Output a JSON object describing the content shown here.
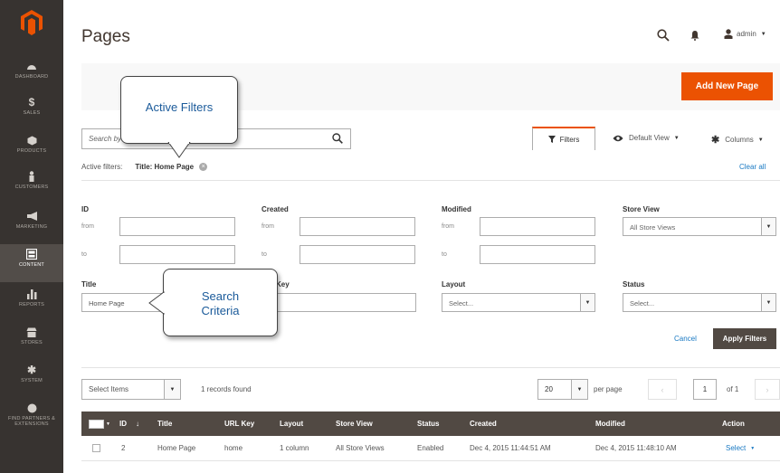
{
  "sidebar": {
    "items": [
      {
        "label": "DASHBOARD",
        "icon": "dashboard-icon"
      },
      {
        "label": "SALES",
        "icon": "dollar-icon"
      },
      {
        "label": "PRODUCTS",
        "icon": "cube-icon"
      },
      {
        "label": "CUSTOMERS",
        "icon": "person-icon"
      },
      {
        "label": "MARKETING",
        "icon": "megaphone-icon"
      },
      {
        "label": "CONTENT",
        "icon": "content-icon"
      },
      {
        "label": "REPORTS",
        "icon": "bar-chart-icon"
      },
      {
        "label": "STORES",
        "icon": "store-icon"
      },
      {
        "label": "SYSTEM",
        "icon": "gear-icon"
      },
      {
        "label": "FIND PARTNERS & EXTENSIONS",
        "icon": "partners-icon"
      }
    ]
  },
  "header": {
    "title": "Pages",
    "user": "admin",
    "add_button": "Add New Page"
  },
  "search": {
    "placeholder": "Search by keyword"
  },
  "toolbar": {
    "filters": "Filters",
    "default_view": "Default View",
    "columns": "Columns"
  },
  "active_filters": {
    "label": "Active filters:",
    "value": "Title: Home Page",
    "clear_all": "Clear all"
  },
  "filters": {
    "id": "ID",
    "created": "Created",
    "modified": "Modified",
    "store_view": "Store View",
    "store_view_value": "All Store Views",
    "from": "from",
    "to": "to",
    "title": "Title",
    "title_value": "Home Page",
    "url_key_partial": "Key",
    "layout": "Layout",
    "layout_value": "Select...",
    "status": "Status",
    "status_value": "Select...",
    "cancel": "Cancel",
    "apply": "Apply Filters"
  },
  "grid_toolbar": {
    "select_items": "Select Items",
    "records_found": "1 records found",
    "per_page_value": "20",
    "per_page_label": "per page",
    "current_page": "1",
    "of_pages": "of 1"
  },
  "table": {
    "headers": [
      "ID",
      "Title",
      "URL Key",
      "Layout",
      "Store View",
      "Status",
      "Created",
      "Modified",
      "Action"
    ],
    "rows": [
      {
        "id": "2",
        "title": "Home Page",
        "url_key": "home",
        "layout": "1 column",
        "store_view": "All Store Views",
        "status": "Enabled",
        "created": "Dec 4, 2015 11:44:51 AM",
        "modified": "Dec 4, 2015 11:48:10 AM",
        "action": "Select"
      }
    ]
  },
  "callouts": {
    "active_filters": "Active Filters",
    "search_criteria_1": "Search",
    "search_criteria_2": "Criteria"
  },
  "colors": {
    "sidebar_bg": "#373330",
    "accent": "#eb5202",
    "grid_header": "#514943",
    "link": "#1979c3"
  }
}
